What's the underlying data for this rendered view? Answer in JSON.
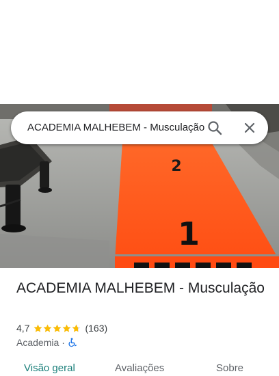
{
  "search": {
    "query": "ACADEMIA MALHEBEM - Musculação",
    "icons": [
      "search-icon",
      "close-icon"
    ]
  },
  "hero_photo": {
    "floor_numbers": [
      "2",
      "1"
    ],
    "colors": {
      "track": "#ff5a1f",
      "floor": "#9c9d9a"
    }
  },
  "place": {
    "title": "ACADEMIA MALHEBEM - Musculação",
    "rating": "4,7",
    "rating_stars": 4.7,
    "review_count": "(163)",
    "category": "Academia",
    "separator": "·",
    "accessibility_icon": "wheelchair-icon"
  },
  "tabs": [
    {
      "label": "Visão geral",
      "active": true
    },
    {
      "label": "Avaliações",
      "active": false
    },
    {
      "label": "Sobre",
      "active": false
    }
  ],
  "colors": {
    "accent": "#1a7f7a",
    "star": "#fbbc04",
    "wheelchair": "#1a73e8"
  }
}
